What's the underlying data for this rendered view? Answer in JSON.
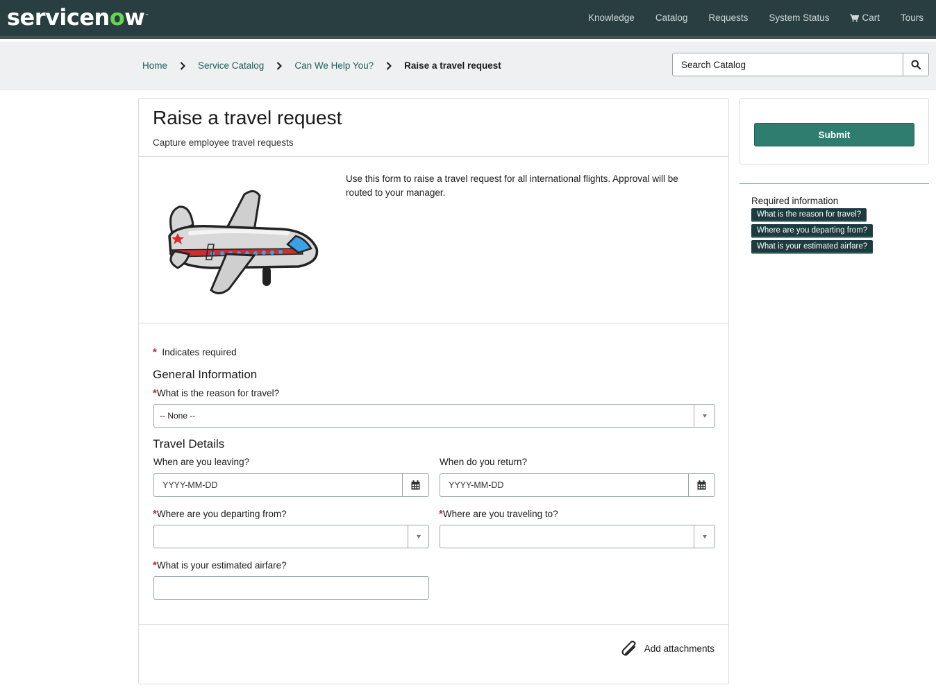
{
  "header": {
    "logo": {
      "part1": "servicen",
      "o": "o",
      "part2": "w",
      "tm": "™"
    },
    "nav": [
      "Knowledge",
      "Catalog",
      "Requests",
      "System Status",
      "Cart",
      "Tours"
    ]
  },
  "breadcrumb": {
    "items": [
      "Home",
      "Service Catalog",
      "Can We Help You?"
    ],
    "current": "Raise a travel request"
  },
  "search": {
    "placeholder": "Search Catalog"
  },
  "item": {
    "title": "Raise a travel request",
    "subtitle": "Capture employee travel requests",
    "description": "Use this form to raise a travel request for all international flights. Approval will be routed to your manager."
  },
  "form": {
    "required_note": "Indicates required",
    "required_star": "*",
    "general_section": "General Information",
    "reason_label": "What is the reason for travel?",
    "reason_value": "-- None --",
    "travel_section": "Travel Details",
    "leaving_label": "When are you leaving?",
    "leaving_placeholder": "YYYY-MM-DD",
    "return_label": "When do you return?",
    "return_placeholder": "YYYY-MM-DD",
    "departing_label": "Where are you departing from?",
    "traveling_label": "Where are you traveling to?",
    "airfare_label": "What is your estimated airfare?",
    "attachments": "Add attachments"
  },
  "sidebar": {
    "submit": "Submit",
    "required_title": "Required information",
    "required_items": [
      "What is the reason for travel?",
      "Where are you departing from?",
      "What is your estimated airfare?"
    ]
  },
  "colors": {
    "header_bg": "#293e40",
    "accent": "#2e7d6f",
    "link": "#1f5e5a",
    "required_star": "#c0262d"
  }
}
